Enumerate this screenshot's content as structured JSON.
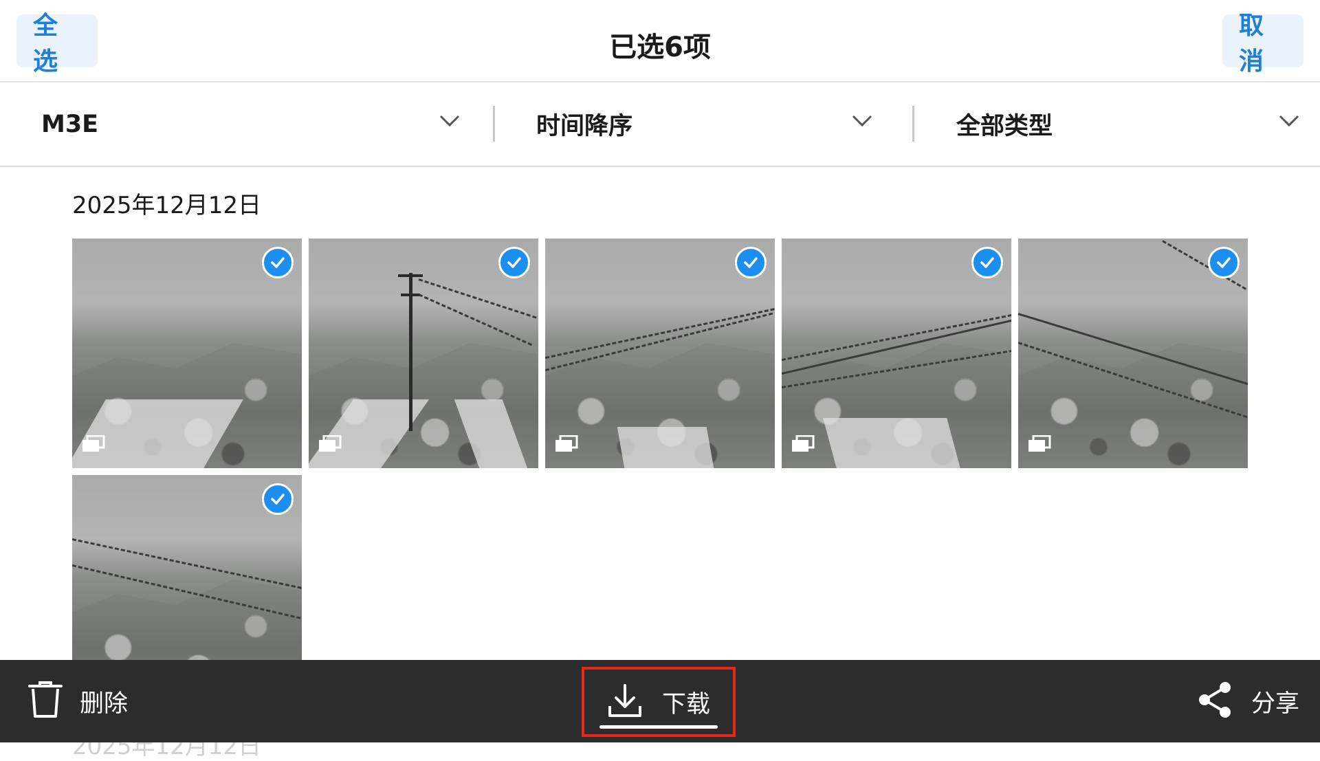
{
  "header": {
    "select_all": "全选",
    "title": "已选6项",
    "cancel": "取消"
  },
  "filters": [
    {
      "label": "M3E",
      "icon": "chevron-down-icon"
    },
    {
      "label": "时间降序",
      "icon": "chevron-down-icon"
    },
    {
      "label": "全部类型",
      "icon": "chevron-down-icon"
    }
  ],
  "gallery": {
    "date": "2025年12月12日",
    "next_date_partial": "2025年12月12日",
    "items": [
      {
        "selected": true,
        "icon": "multi-photo-icon"
      },
      {
        "selected": true,
        "icon": "multi-photo-icon"
      },
      {
        "selected": true,
        "icon": "multi-photo-icon"
      },
      {
        "selected": true,
        "icon": "multi-photo-icon"
      },
      {
        "selected": true,
        "icon": "multi-photo-icon"
      },
      {
        "selected": true,
        "icon": "multi-photo-icon"
      }
    ]
  },
  "actions": {
    "delete": "删除",
    "download": "下载",
    "share": "分享"
  },
  "colors": {
    "accent": "#1e7fd9",
    "check": "#1b8ef0",
    "action_bar": "#2c2c2c",
    "highlight": "#e8261a"
  }
}
